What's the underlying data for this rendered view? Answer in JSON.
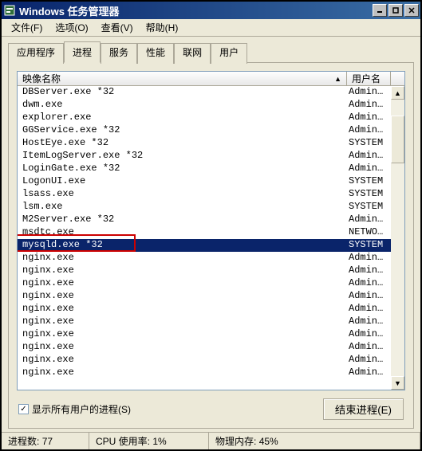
{
  "window": {
    "title": "Windows 任务管理器"
  },
  "menu": {
    "file": "文件(F)",
    "options": "选项(O)",
    "view": "查看(V)",
    "help": "帮助(H)"
  },
  "tabs": {
    "applications": "应用程序",
    "processes": "进程",
    "services": "服务",
    "performance": "性能",
    "networking": "联网",
    "users": "用户"
  },
  "columns": {
    "image_name": "映像名称",
    "user_name": "用户名"
  },
  "processes": [
    {
      "name": "DBServer.exe *32",
      "user": "Admin…",
      "selected": false
    },
    {
      "name": "dwm.exe",
      "user": "Admin…",
      "selected": false
    },
    {
      "name": "explorer.exe",
      "user": "Admin…",
      "selected": false
    },
    {
      "name": "GGService.exe *32",
      "user": "Admin…",
      "selected": false
    },
    {
      "name": "HostEye.exe *32",
      "user": "SYSTEM",
      "selected": false
    },
    {
      "name": "ItemLogServer.exe *32",
      "user": "Admin…",
      "selected": false
    },
    {
      "name": "LoginGate.exe *32",
      "user": "Admin…",
      "selected": false
    },
    {
      "name": "LogonUI.exe",
      "user": "SYSTEM",
      "selected": false
    },
    {
      "name": "lsass.exe",
      "user": "SYSTEM",
      "selected": false
    },
    {
      "name": "lsm.exe",
      "user": "SYSTEM",
      "selected": false
    },
    {
      "name": "M2Server.exe *32",
      "user": "Admin…",
      "selected": false
    },
    {
      "name": "msdtc.exe",
      "user": "NETWO…",
      "selected": false
    },
    {
      "name": "mysqld.exe *32",
      "user": "SYSTEM",
      "selected": true
    },
    {
      "name": "nginx.exe",
      "user": "Admin…",
      "selected": false
    },
    {
      "name": "nginx.exe",
      "user": "Admin…",
      "selected": false
    },
    {
      "name": "nginx.exe",
      "user": "Admin…",
      "selected": false
    },
    {
      "name": "nginx.exe",
      "user": "Admin…",
      "selected": false
    },
    {
      "name": "nginx.exe",
      "user": "Admin…",
      "selected": false
    },
    {
      "name": "nginx.exe",
      "user": "Admin…",
      "selected": false
    },
    {
      "name": "nginx.exe",
      "user": "Admin…",
      "selected": false
    },
    {
      "name": "nginx.exe",
      "user": "Admin…",
      "selected": false
    },
    {
      "name": "nginx.exe",
      "user": "Admin…",
      "selected": false
    },
    {
      "name": "nginx.exe",
      "user": "Admin…",
      "selected": false
    }
  ],
  "footer": {
    "show_all_label": "显示所有用户的进程(S)",
    "end_process_label": "结束进程(E)"
  },
  "status": {
    "proc_count_label": "进程数:",
    "proc_count": "77",
    "cpu_label": "CPU 使用率:",
    "cpu": "1%",
    "mem_label": "物理内存:",
    "mem": "45%"
  },
  "highlight_target": "mysqld.exe *32"
}
